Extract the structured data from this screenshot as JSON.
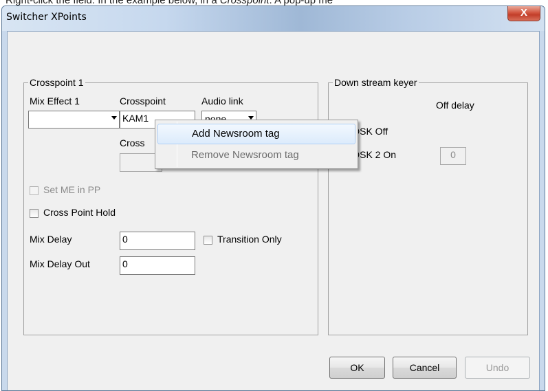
{
  "caption": {
    "text_before": "Right-click the field. In the example below, in a ",
    "text_italic": "Crosspoint",
    "text_after": ". A pop-up me"
  },
  "window": {
    "title": "Switcher XPoints",
    "close_glyph": "X"
  },
  "crosspoint_group": {
    "legend": "Crosspoint 1",
    "mix_effect_label": "Mix Effect 1",
    "mix_effect_value": "",
    "crosspoint_label": "Crosspoint",
    "crosspoint_value": "KAM1",
    "audio_link_label": "Audio link",
    "audio_link_value": "none",
    "crosspoint2_label": "Cross",
    "crosspoint2_value": "",
    "set_me_in_pp_label": "Set ME in PP",
    "set_me_in_pp_checked": false,
    "cross_point_hold_label": "Cross Point Hold",
    "cross_point_hold_checked": false,
    "mix_delay_label": "Mix Delay",
    "mix_delay_value": "0",
    "transition_only_label": "Transition Only",
    "transition_only_checked": false,
    "mix_delay_out_label": "Mix Delay Out",
    "mix_delay_out_value": "0"
  },
  "dsk_group": {
    "legend": "Down stream keyer",
    "off_delay_label": "Off delay",
    "dsk_off_label": "DSK Off",
    "dsk_off_checked": false,
    "dsk2_on_label": "DSK 2 On",
    "dsk2_on_checked": false,
    "dsk2_off_delay_value": "0"
  },
  "buttons": {
    "ok": "OK",
    "cancel": "Cancel",
    "undo": "Undo"
  },
  "context_menu": {
    "items": [
      {
        "label": "Add Newsroom tag",
        "state": "highlighted"
      },
      {
        "label": "Remove Newsroom tag",
        "state": "disabled"
      }
    ]
  }
}
